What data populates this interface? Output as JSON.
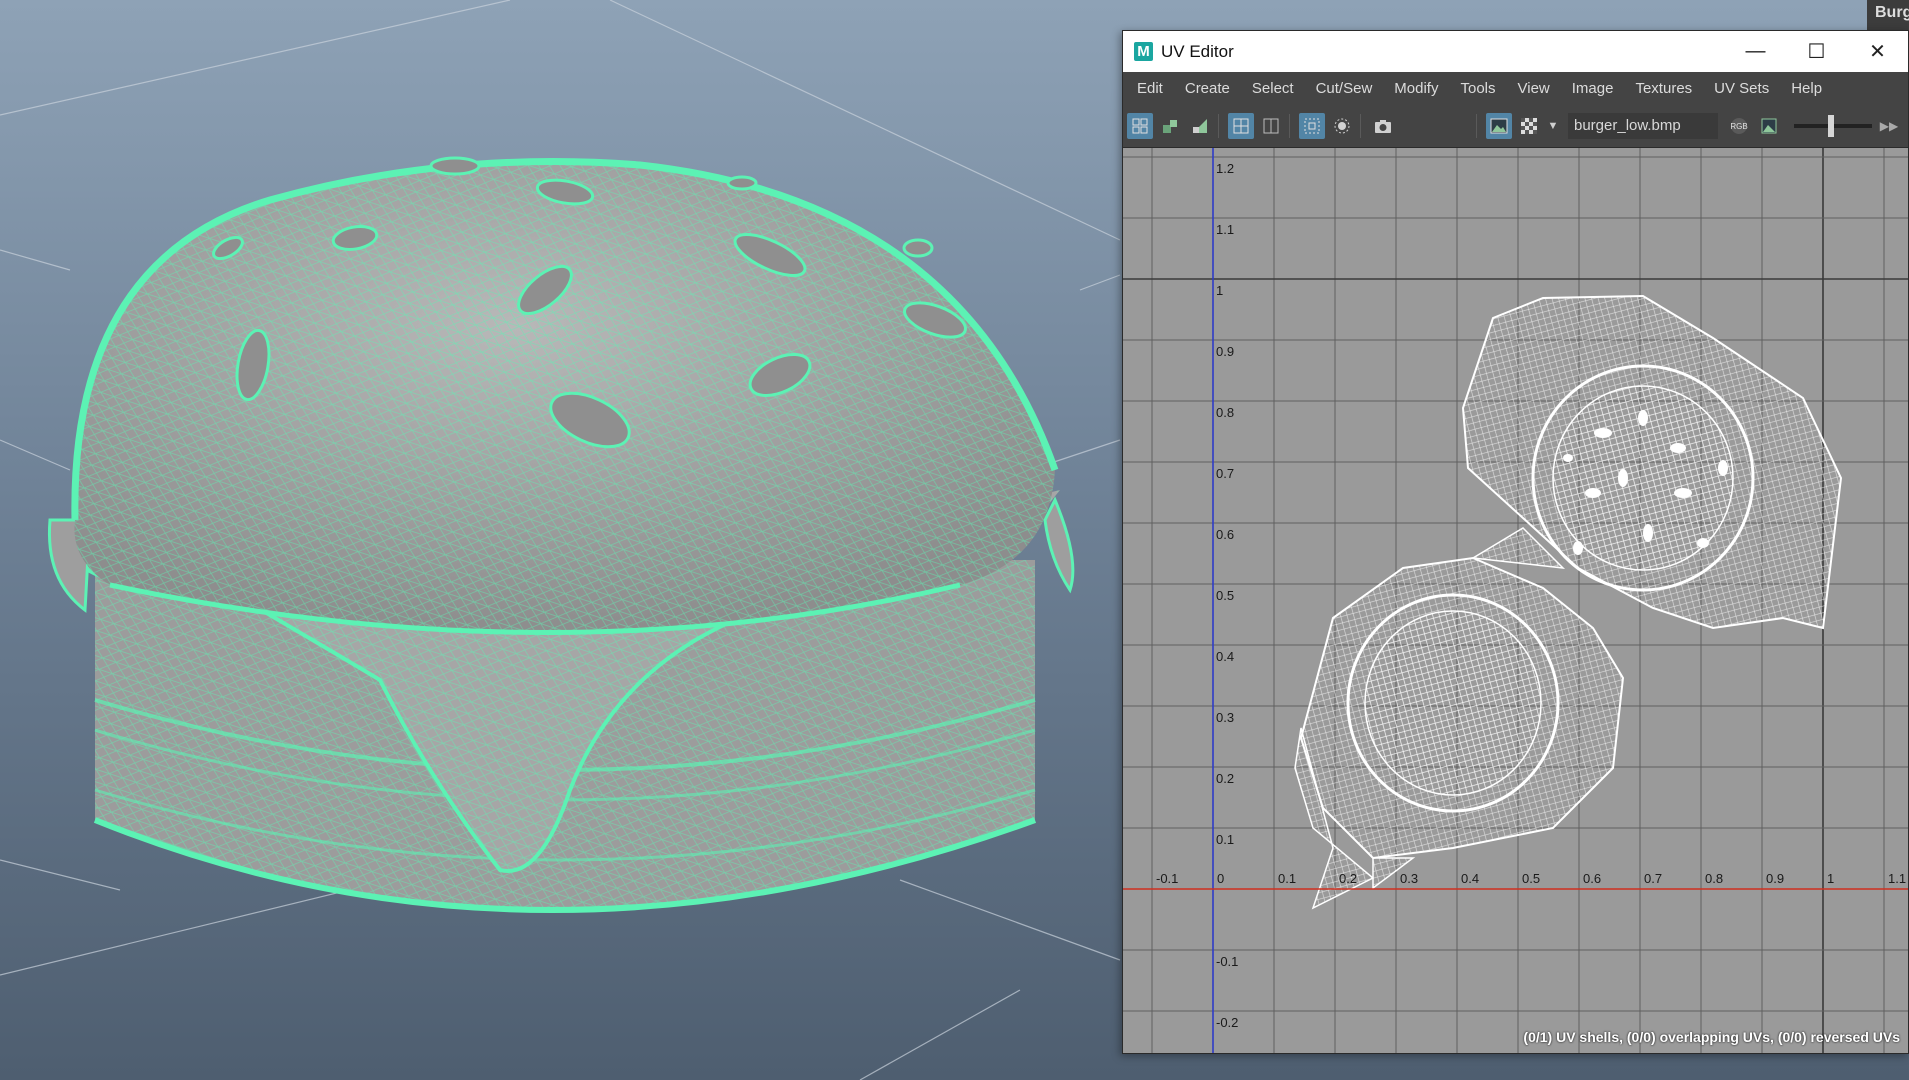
{
  "corner_tab": {
    "label": "Burg"
  },
  "uv_editor": {
    "title": "UV Editor",
    "logo_letter": "M",
    "window_controls": {
      "minimize": "—",
      "maximize": "☐",
      "close": "✕"
    },
    "menu": [
      "Edit",
      "Create",
      "Select",
      "Cut/Sew",
      "Modify",
      "Tools",
      "View",
      "Image",
      "Textures",
      "UV Sets",
      "Help"
    ],
    "toolbar": {
      "image_name": "burger_low.bmp",
      "rgb_label": "RGB"
    },
    "axes": {
      "u_labels": [
        "-0.1",
        "0",
        "0.1",
        "0.2",
        "0.3",
        "0.4",
        "0.5",
        "0.6",
        "0.7",
        "0.8",
        "0.9",
        "1",
        "1.1"
      ],
      "v_labels": [
        "1.2",
        "1.1",
        "1",
        "0.9",
        "0.8",
        "0.7",
        "0.6",
        "0.5",
        "0.4",
        "0.3",
        "0.2",
        "0.1",
        "0",
        "-0.1",
        "-0.2"
      ]
    },
    "status": "(0/1) UV shells, (0/0) overlapping UVs, (0/0) reversed UVs"
  },
  "colors": {
    "wireframe": "#5cf2b4",
    "uv_grid_bg": "#9a9a9a",
    "uv_v_axis": "#2e3cc8",
    "uv_u_axis": "#d0301f",
    "active_button": "#5285a6"
  },
  "icons": [
    "uv-shell-icon",
    "uv-layout-icon",
    "uv-unfold-icon",
    "uv-grid-icon",
    "uv-snap-icon",
    "uv-pixel-snap-icon",
    "shading-icon",
    "camera-icon",
    "image-display-icon",
    "checker-icon",
    "dropdown-arrow-icon",
    "rgb-channel-icon",
    "image-icon",
    "slider",
    "expand-arrow-icon"
  ]
}
